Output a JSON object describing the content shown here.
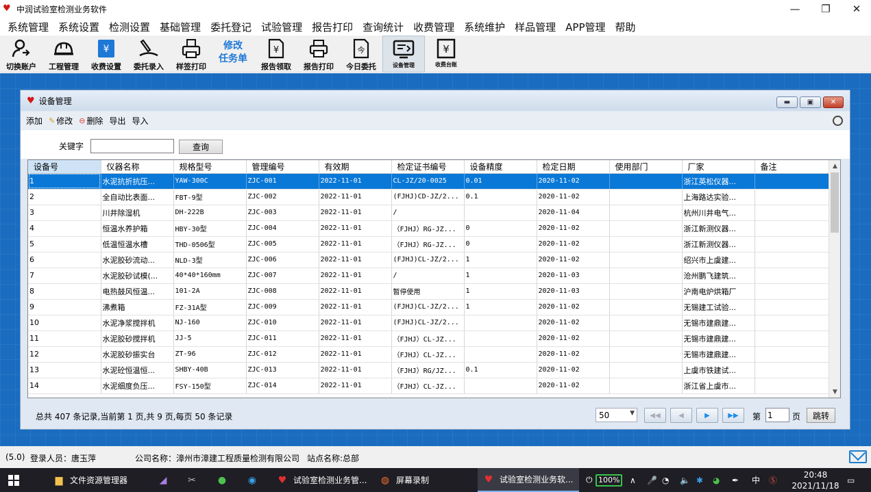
{
  "window": {
    "title": "中润试验室检测业务软件",
    "minimize": "—",
    "maximize": "❐",
    "close": "✕"
  },
  "menu": [
    "系统管理",
    "系统设置",
    "检测设置",
    "基础管理",
    "委托登记",
    "试验管理",
    "报告打印",
    "查询统计",
    "收费管理",
    "系统维护",
    "样品管理",
    "APP管理",
    "帮助"
  ],
  "toolbar": {
    "switch_account": "切换账户",
    "project_mgmt": "工程管理",
    "fee_settings": "收费设置",
    "commission_entry": "委托录入",
    "label_print": "样签打印",
    "modify_task_line1": "修改",
    "modify_task_line2": "任务单",
    "report_collect": "报告领取",
    "report_print": "报告打印",
    "today_commission": "今日委托",
    "equipment_mgmt": "设备管理",
    "fee_ledger": "收费台账"
  },
  "child": {
    "title": "设备管理",
    "actions": {
      "add": "添加",
      "edit": "修改",
      "delete": "删除",
      "export": "导出",
      "import": "导入"
    },
    "keyword_label": "关键字",
    "keyword_value": "",
    "query_button": "查询"
  },
  "grid": {
    "columns": [
      "设备号",
      "仪器名称",
      "规格型号",
      "管理编号",
      "有效期",
      "检定证书编号",
      "设备精度",
      "检定日期",
      "使用部门",
      "厂家",
      "备注"
    ],
    "rows": [
      [
        "1",
        "水泥抗折抗压...",
        "YAW-300C",
        "ZJC-001",
        "2022-11-01",
        "CL-JZ/20-0025",
        "0.01",
        "2020-11-02",
        "",
        "浙江英松仪器...",
        ""
      ],
      [
        "2",
        "全自动比表面...",
        "FBT-9型",
        "ZJC-002",
        "2022-11-01",
        "(FJHJ)CD-JZ/2...",
        "0.1",
        "2020-11-02",
        "",
        "上海路达实验...",
        ""
      ],
      [
        "3",
        "川井除湿机",
        "DH-222B",
        "ZJC-003",
        "2022-11-01",
        "/",
        "",
        "2020-11-04",
        "",
        "杭州川井电气...",
        ""
      ],
      [
        "4",
        "恒温水养护箱",
        "HBY-30型",
        "ZJC-004",
        "2022-11-01",
        "（FJHJ）RG-JZ...",
        "0",
        "2020-11-02",
        "",
        "浙江新测仪器...",
        ""
      ],
      [
        "5",
        "低温恒温水槽",
        "THD-0506型",
        "ZJC-005",
        "2022-11-01",
        "（FJHJ）RG-JZ...",
        "0",
        "2020-11-02",
        "",
        "浙江新测仪器...",
        ""
      ],
      [
        "6",
        "水泥胶砂流动...",
        "NLD-3型",
        "ZJC-006",
        "2022-11-01",
        "(FJHJ)CL-JZ/2...",
        "1",
        "2020-11-02",
        "",
        "绍兴市上虞建...",
        ""
      ],
      [
        "7",
        "水泥胶砂试模(...",
        "40*40*160mm",
        "ZJC-007",
        "2022-11-01",
        "/",
        "1",
        "2020-11-03",
        "",
        "沧州鹏飞建筑...",
        ""
      ],
      [
        "8",
        "电热鼓风恒温...",
        "101-2A",
        "ZJC-008",
        "2022-11-01",
        "暂停使用",
        "1",
        "2020-11-03",
        "",
        "沪南电炉烘箱厂",
        ""
      ],
      [
        "9",
        "沸煮箱",
        "FZ-31A型",
        "ZJC-009",
        "2022-11-01",
        "(FJHJ)CL-JZ/2...",
        "1",
        "2020-11-02",
        "",
        "无锡建工试验...",
        ""
      ],
      [
        "10",
        "水泥净浆搅拌机",
        "NJ-160",
        "ZJC-010",
        "2022-11-01",
        "(FJHJ)CL-JZ/2...",
        "",
        "2020-11-02",
        "",
        "无锡市建鼎建...",
        ""
      ],
      [
        "11",
        "水泥胶砂搅拌机",
        "JJ-5",
        "ZJC-011",
        "2022-11-01",
        "（FJHJ）CL-JZ...",
        "",
        "2020-11-02",
        "",
        "无锡市建鼎建...",
        ""
      ],
      [
        "12",
        "水泥胶砂振实台",
        "ZT-96",
        "ZJC-012",
        "2022-11-01",
        "（FJHJ）CL-JZ...",
        "",
        "2020-11-02",
        "",
        "无锡市建鼎建...",
        ""
      ],
      [
        "13",
        "水泥砼恒温恒...",
        "SHBY-40B",
        "ZJC-013",
        "2022-11-01",
        "（FJHJ）RG/JZ...",
        "0.1",
        "2020-11-02",
        "",
        "上虞市铁建试...",
        ""
      ],
      [
        "14",
        "水泥细度负压...",
        "FSY-150型",
        "ZJC-014",
        "2022-11-01",
        "（FJHJ）CL-JZ...",
        "",
        "2020-11-02",
        "",
        "浙江省上虞市...",
        ""
      ]
    ]
  },
  "pager": {
    "summary": "总共 407 条记录,当前第 1 页,共 9 页,每页 50 条记录",
    "page_size": "50",
    "page_label_pre": "第",
    "page_value": "1",
    "page_label_post": "页",
    "jump": "跳转"
  },
  "status": {
    "version": "(5.0)",
    "login_user": "登录人员：唐玉萍",
    "company": "公司名称：漳州市漳建工程质量检测有限公司",
    "site": "站点名称:总部"
  },
  "taskbar": {
    "file_explorer": "文件资源管理器",
    "app1": "试验室检测业务管...",
    "screen_record": "屏幕录制",
    "app2": "试验室检测业务软...",
    "battery": "100%",
    "ime": "中",
    "time": "20:48",
    "date": "2021/11/18"
  }
}
